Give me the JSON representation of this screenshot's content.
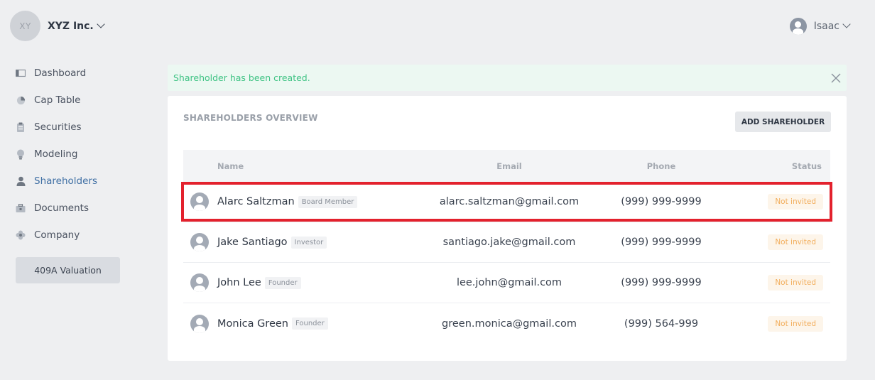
{
  "company": {
    "initials": "XY",
    "name": "XYZ Inc."
  },
  "user": {
    "name": "Isaac"
  },
  "sidebar": {
    "items": [
      {
        "label": "Dashboard",
        "icon": "dashboard-icon"
      },
      {
        "label": "Cap Table",
        "icon": "pie-chart-icon"
      },
      {
        "label": "Securities",
        "icon": "clipboard-icon"
      },
      {
        "label": "Modeling",
        "icon": "lightbulb-icon"
      },
      {
        "label": "Shareholders",
        "icon": "person-icon",
        "active": true
      },
      {
        "label": "Documents",
        "icon": "briefcase-icon"
      },
      {
        "label": "Company",
        "icon": "flower-icon"
      }
    ],
    "valuation_label": "409A Valuation"
  },
  "alert": {
    "message": "Shareholder has been created."
  },
  "card": {
    "title": "SHAREHOLDERS OVERVIEW",
    "add_label": "ADD SHAREHOLDER",
    "columns": {
      "name": "Name",
      "email": "Email",
      "phone": "Phone",
      "status": "Status"
    },
    "rows": [
      {
        "name": "Alarc Saltzman",
        "role": "Board Member",
        "email": "alarc.saltzman@gmail.com",
        "phone": "(999) 999-9999",
        "status": "Not invited"
      },
      {
        "name": "Jake Santiago",
        "role": "Investor",
        "email": "santiago.jake@gmail.com",
        "phone": "(999) 999-9999",
        "status": "Not invited"
      },
      {
        "name": "John Lee",
        "role": "Founder",
        "email": "lee.john@gmail.com",
        "phone": "(999) 999-9999",
        "status": "Not invited"
      },
      {
        "name": "Monica Green",
        "role": "Founder",
        "email": "green.monica@gmail.com",
        "phone": "(999) 564-999",
        "status": "Not invited"
      }
    ]
  },
  "colors": {
    "active_nav": "#3f6fa4",
    "success_text": "#3fc384",
    "success_bg": "#ecf8f2",
    "status_text": "#f2ad5b",
    "highlight_border": "#e3212d"
  }
}
